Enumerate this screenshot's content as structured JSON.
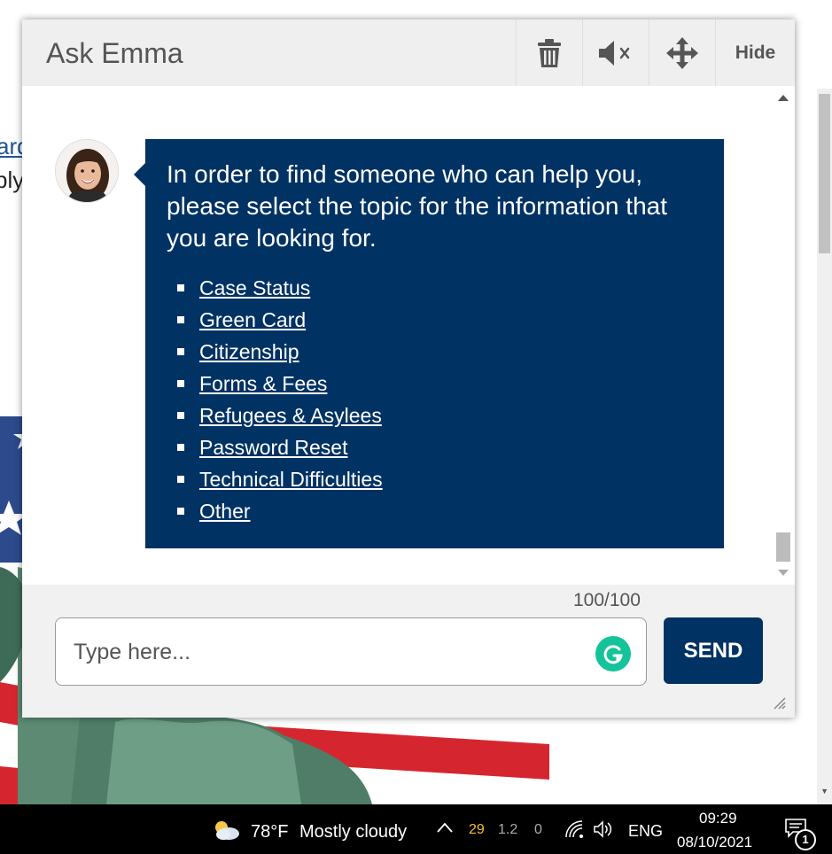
{
  "background_page": {
    "link_fragment": "ard",
    "text_fragment": "ply"
  },
  "chat": {
    "title": "Ask Emma",
    "header_buttons": {
      "delete_icon": "trash-icon",
      "mute_icon": "speaker-muted-icon",
      "move_icon": "move-arrows-icon",
      "hide_label": "Hide"
    },
    "message": {
      "text": "In order to find someone who can help you, please select the topic for the information that you are looking for.",
      "topics": [
        "Case Status",
        "Green Card",
        "Citizenship",
        "Forms & Fees",
        "Refugees & Asylees",
        "Password Reset",
        "Technical Difficulties",
        "Other"
      ]
    },
    "char_count": "100/100",
    "input": {
      "placeholder": "Type here...",
      "value": ""
    },
    "send_label": "SEND",
    "colors": {
      "primary": "#003263",
      "grammarly": "#15c39a"
    }
  },
  "taskbar": {
    "weather_icon": "partly-cloudy-icon",
    "temperature": "78°F",
    "weather_desc": "Mostly cloudy",
    "tray_num1": "29",
    "tray_num2": "1.2",
    "tray_num3": "0",
    "language": "ENG",
    "time": "09:29",
    "date": "08/10/2021",
    "notification_count": "1"
  }
}
